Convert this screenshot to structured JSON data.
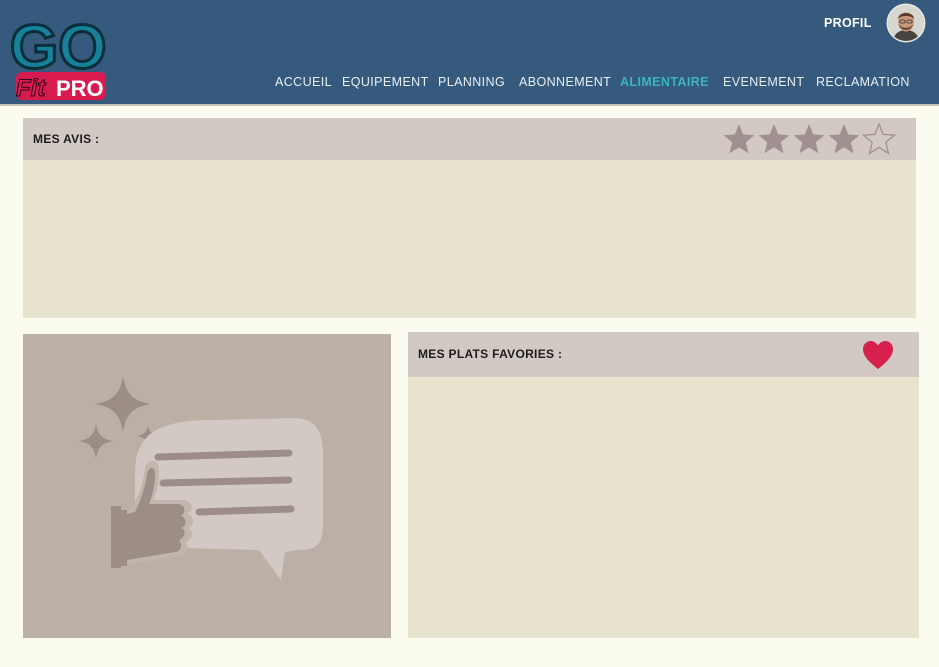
{
  "header": {
    "logo": {
      "text_top": "GO",
      "text_bottom_left": "Fit",
      "text_bottom_right": "PRO"
    },
    "profile_label": "PROFIL",
    "avatar_icon": "user-avatar",
    "nav": [
      {
        "label": "ACCUEIL",
        "active": false
      },
      {
        "label": "EQUIPEMENT",
        "active": false
      },
      {
        "label": "PLANNING",
        "active": false
      },
      {
        "label": "ABONNEMENT",
        "active": false
      },
      {
        "label": "ALIMENTAIRE",
        "active": true
      },
      {
        "label": "EVENEMENT",
        "active": false
      },
      {
        "label": "RECLAMATION",
        "active": false
      }
    ],
    "colors": {
      "bar": "#355a7d",
      "active_link": "#3bb3c3",
      "link": "#e9eef2"
    }
  },
  "reviews": {
    "title": "MES AVIS :",
    "rating": 4,
    "max_rating": 5,
    "star_icon": "star-icon",
    "colors": {
      "filled": "#a09090",
      "empty": "#a09090"
    }
  },
  "favorites": {
    "title": "MES PLATS FAVORIES :",
    "heart_icon": "heart-icon",
    "colors": {
      "heart": "#d6204e"
    }
  },
  "illustration": {
    "icon": "thumbs-up-review-icon",
    "colors": {
      "background": "#bbafa6",
      "bubble": "#d3c9c4",
      "hand": "#9c8e87"
    }
  }
}
